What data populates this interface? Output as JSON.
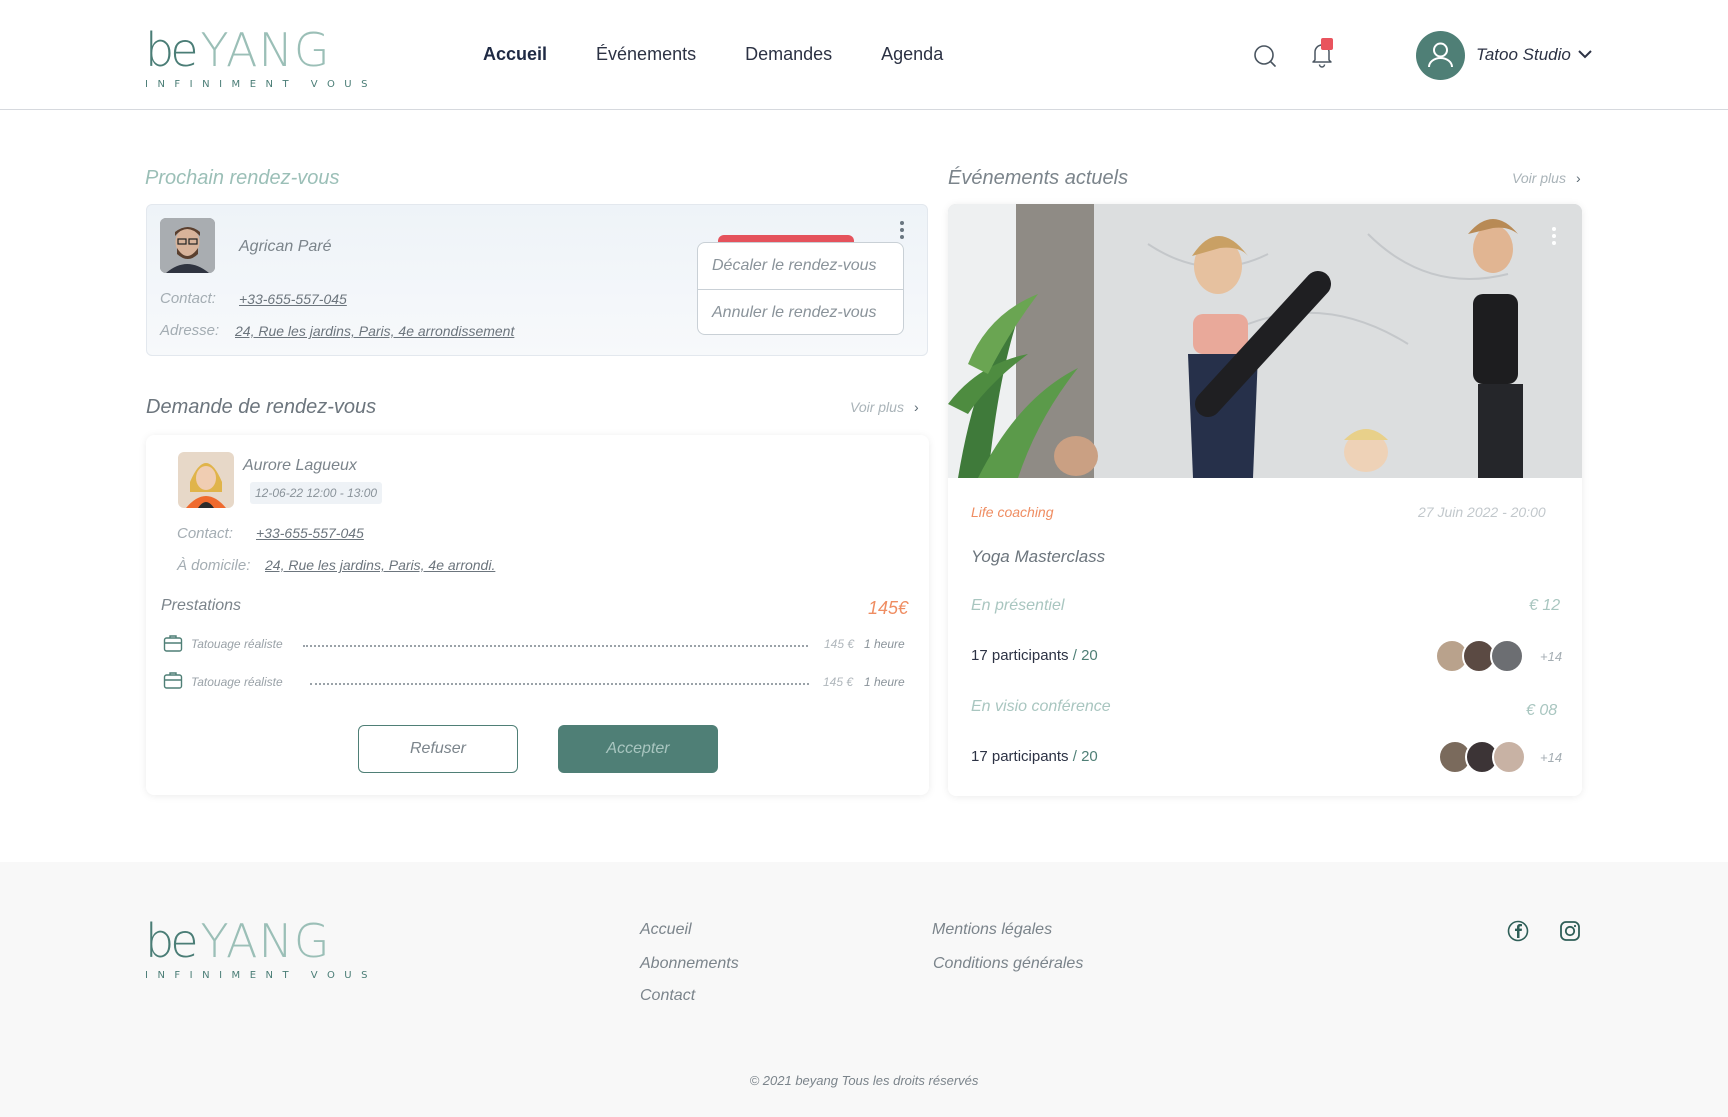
{
  "header": {
    "logo": {
      "be": "be",
      "yang": "YANG",
      "tagline": "INFINIMENT VOUS"
    },
    "nav": [
      "Accueil",
      "Événements",
      "Demandes",
      "Agenda"
    ],
    "user": {
      "name": "Tatoo Studio"
    },
    "notification_badge_color": "#e9545e"
  },
  "next_appointment": {
    "title": "Prochain rendez-vous",
    "name": "Agrican Paré",
    "contact_label": "Contact:",
    "contact": "+33-655-557-045",
    "address_label": "Adresse:",
    "address": "24, Rue les jardins, Paris,  4e arrondissement",
    "menu": [
      "Décaler le rendez-vous",
      "Annuler le rendez-vous"
    ]
  },
  "request": {
    "title": "Demande de rendez-vous",
    "see_more": "Voir plus",
    "name": "Aurore Lagueux",
    "date": "12-06-22  12:00 - 13:00",
    "contact_label": "Contact:",
    "contact": "+33-655-557-045",
    "home_label": "À domicile:",
    "address": "24, Rue les jardins, Paris, 4e arrondi.",
    "prestations_label": "Prestations",
    "total": "145€",
    "services": [
      {
        "name": "Tatouage réaliste",
        "price": "145 €",
        "duration": "1 heure"
      },
      {
        "name": "Tatouage réaliste",
        "price": "145 €",
        "duration": "1 heure"
      }
    ],
    "refuse": "Refuser",
    "accept": "Accepter"
  },
  "events": {
    "title": "Événements actuels",
    "see_more": "Voir plus",
    "category": "Life coaching",
    "date": "27 Juin 2022 - 20:00",
    "event_title": "Yoga Masterclass",
    "options": [
      {
        "mode": "En présentiel",
        "price": "€ 12",
        "participants": "17 participants",
        "max": " / 20",
        "more": "+14"
      },
      {
        "mode": "En visio conférence",
        "price": "€ 08",
        "participants": "17 participants",
        "max": " / 20",
        "more": "+14"
      }
    ]
  },
  "footer": {
    "links_col1": [
      "Accueil",
      "Abonnements",
      "Contact"
    ],
    "links_col2": [
      "Mentions légales",
      "Conditions générales"
    ],
    "copyright": "© 2021 beyang  Tous les droits réservés"
  },
  "colors": {
    "brand": "#4f7f76",
    "brand_light": "#a9c6c0",
    "accent_orange": "#ef8d62",
    "danger": "#e5525c"
  },
  "icons": [
    "search-icon",
    "bell-icon",
    "user-icon",
    "chevron-down-icon",
    "kebab-icon",
    "briefcase-icon",
    "chevron-right-icon",
    "facebook-icon",
    "instagram-icon"
  ]
}
